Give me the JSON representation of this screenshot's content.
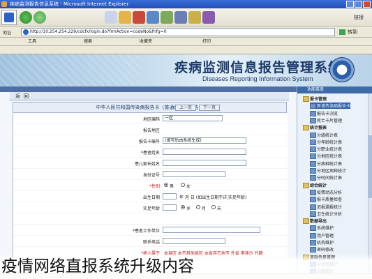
{
  "window": {
    "title": "疾病监测报告信息系统 - Microsoft Internet Explorer"
  },
  "toolbar": {
    "go_label": "链接"
  },
  "address": {
    "label": "地址",
    "url": "http://10.254.254.229/cdcfx/login.do?frmAction=codeNo&fnfg=0",
    "go": "转到"
  },
  "links": [
    "工具",
    "搜索",
    "收藏夹",
    "打印"
  ],
  "banner": {
    "title_cn": "疾病监测信息报告管理系统",
    "title_en": "Diseases Reporting Information System"
  },
  "form": {
    "tabs": [
      "返",
      "回"
    ],
    "card_title": "中华人民共和国传染病报告卡（普通传染病报告）",
    "rows": [
      {
        "label": "地区编码",
        "value": "一区"
      },
      {
        "label": "报告地区",
        "value": ""
      },
      {
        "label": "报告卡编号",
        "value": "(填写后由系统生成)"
      },
      {
        "label": "*患者姓名",
        "value": ""
      },
      {
        "label": "患儿家长姓名",
        "value": ""
      },
      {
        "label": "身份证号",
        "value": ""
      },
      {
        "label": "*性别",
        "value": "男"
      },
      {
        "label": "出生日期",
        "value": "年    月    日   (如出生日期不详,实足年龄)"
      },
      {
        "label": "实足年龄",
        "value": ""
      },
      {
        "label": "*患者工作单位",
        "value": ""
      },
      {
        "label": "联系电话",
        "value": ""
      },
      {
        "label": "*病人属于",
        "value": "本县区   本市其他县区   本省其它地市   外省   港澳台   外籍"
      }
    ],
    "sex_options": [
      "男",
      "女"
    ],
    "unit_options": [
      "岁",
      "月",
      "天"
    ],
    "nav_buttons": [
      "上一页",
      "下一页"
    ]
  },
  "sidebar": {
    "header": "功能菜单",
    "items": [
      {
        "label": "报卡管理",
        "folder": true
      },
      {
        "label": "新增传染病报告卡",
        "folder": false,
        "selected": true
      },
      {
        "label": "报告卡浏览",
        "folder": false
      },
      {
        "label": "死亡卡片管理",
        "folder": false
      },
      {
        "label": "统计报表",
        "folder": true
      },
      {
        "label": "分级统计表",
        "folder": false
      },
      {
        "label": "分年龄统计表",
        "folder": false
      },
      {
        "label": "分职业统计表",
        "folder": false
      },
      {
        "label": "分地区统计表",
        "folder": false
      },
      {
        "label": "分病种统计表",
        "folder": false
      },
      {
        "label": "分地区病种统计",
        "folder": false
      },
      {
        "label": "分时间统计表",
        "folder": false
      },
      {
        "label": "综合统计",
        "folder": true
      },
      {
        "label": "疫情动态分析",
        "folder": false
      },
      {
        "label": "报卡质量检查",
        "folder": false
      },
      {
        "label": "迟报漏报统计",
        "folder": false
      },
      {
        "label": "卫生统计分析",
        "folder": false
      },
      {
        "label": "数据导出",
        "folder": true
      },
      {
        "label": "系统维护",
        "folder": false
      },
      {
        "label": "用户管理",
        "folder": false
      },
      {
        "label": "机构维护",
        "folder": false
      },
      {
        "label": "密码修改",
        "folder": false
      },
      {
        "label": "基础信息管理",
        "folder": true
      },
      {
        "label": "分地区统计",
        "folder": false
      },
      {
        "label": "分组统计",
        "folder": false
      }
    ]
  },
  "caption": "疫情网络直报系统升级内容"
}
